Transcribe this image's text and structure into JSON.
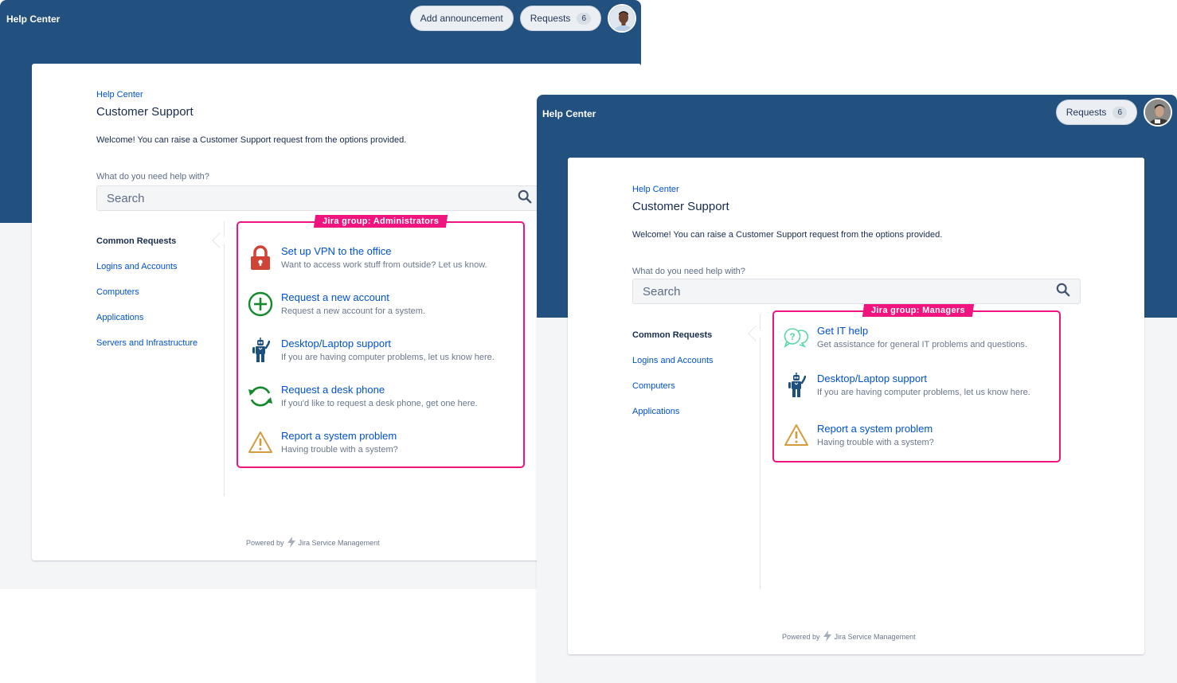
{
  "portals": [
    {
      "header": {
        "title": "Help Center",
        "add_announcement": "Add announcement",
        "requests_label": "Requests",
        "requests_count": "6"
      },
      "breadcrumb": "Help Center",
      "page_title": "Customer Support",
      "welcome": "Welcome! You can raise a Customer Support request from the options provided.",
      "help_label": "What do you need help with?",
      "search_placeholder": "Search",
      "nav": [
        "Common Requests",
        "Logins and Accounts",
        "Computers",
        "Applications",
        "Servers and Infrastructure"
      ],
      "group_tag": "Jira group: Administrators",
      "requests": [
        {
          "icon": "lock-icon",
          "title": "Set up VPN to the office",
          "desc": "Want to access work stuff from outside? Let us know."
        },
        {
          "icon": "plus-circle-icon",
          "title": "Request a new account",
          "desc": "Request a new account for a system."
        },
        {
          "icon": "robot-icon",
          "title": "Desktop/Laptop support",
          "desc": "If you are having computer problems, let us know here."
        },
        {
          "icon": "refresh-icon",
          "title": "Request a desk phone",
          "desc": "If you'd like to request a desk phone, get one here."
        },
        {
          "icon": "warning-icon",
          "title": "Report a system problem",
          "desc": "Having trouble with a system?"
        }
      ],
      "footer": {
        "powered_by": "Powered by",
        "product": "Jira Service Management"
      }
    },
    {
      "header": {
        "title": "Help Center",
        "requests_label": "Requests",
        "requests_count": "6"
      },
      "breadcrumb": "Help Center",
      "page_title": "Customer Support",
      "welcome": "Welcome! You can raise a Customer Support request from the options provided.",
      "help_label": "What do you need help with?",
      "search_placeholder": "Search",
      "nav": [
        "Common Requests",
        "Logins and Accounts",
        "Computers",
        "Applications"
      ],
      "group_tag": "Jira group: Managers",
      "requests": [
        {
          "icon": "chat-question-icon",
          "title": "Get IT help",
          "desc": "Get assistance for general IT problems and questions."
        },
        {
          "icon": "robot-icon",
          "title": "Desktop/Laptop support",
          "desc": "If you are having computer problems, let us know here."
        },
        {
          "icon": "warning-icon",
          "title": "Report a system problem",
          "desc": "Having trouble with a system?"
        }
      ],
      "footer": {
        "powered_by": "Powered by",
        "product": "Jira Service Management"
      }
    }
  ],
  "colors": {
    "banner": "#22507f",
    "link": "#0052cc",
    "group_highlight": "#f0147e"
  }
}
